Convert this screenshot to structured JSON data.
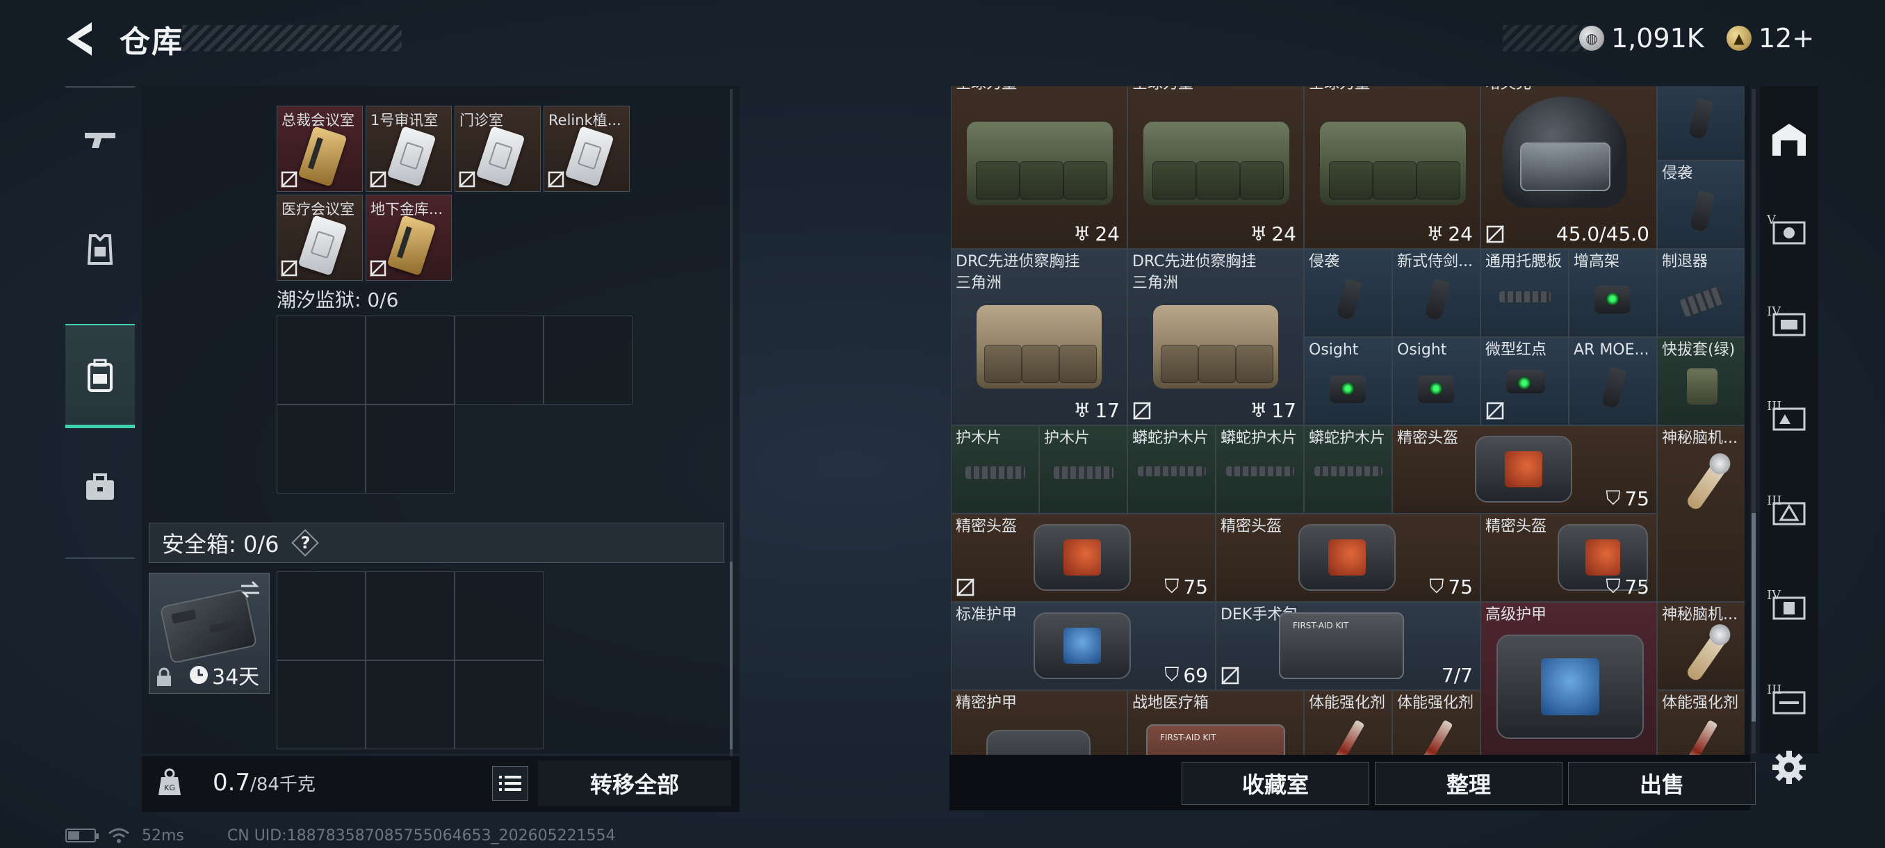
{
  "header": {
    "title": "仓库",
    "currency_silver": "1,091K",
    "currency_gold": "12+"
  },
  "left_nav": {
    "items": [
      {
        "icon": "gun-icon"
      },
      {
        "icon": "armor-vest-icon"
      },
      {
        "icon": "backpack-icon",
        "active": true
      },
      {
        "icon": "briefcase-icon"
      }
    ]
  },
  "left_panel": {
    "keycards": [
      {
        "label": "总裁会议室",
        "style": "gold",
        "bg": "red"
      },
      {
        "label": "1号审讯室",
        "style": "white",
        "bg": "brown"
      },
      {
        "label": "门诊室",
        "style": "white",
        "bg": "brown"
      },
      {
        "label": "Relink植...",
        "style": "white",
        "bg": "brown"
      },
      {
        "label": "医疗会议室",
        "style": "white",
        "bg": "brown"
      },
      {
        "label": "地下金库...",
        "style": "gold",
        "bg": "red"
      }
    ],
    "prison_section": "潮汐监狱: 0/6",
    "safebox_label": "安全箱: 0/6",
    "help_label": "?",
    "case_days": "34天",
    "weight_value": "0.7",
    "weight_max": "/84千克",
    "transfer_all": "转移全部"
  },
  "right_panel": {
    "items": [
      {
        "id": "r1",
        "label": "全球力量",
        "count": "24"
      },
      {
        "id": "r2",
        "label": "全球力量",
        "count": "24"
      },
      {
        "id": "r3",
        "label": "全球力量",
        "count": "24"
      },
      {
        "id": "r4",
        "label": "哈夫克",
        "count": "45.0/45.0"
      },
      {
        "id": "r5",
        "label": "侵袭"
      },
      {
        "id": "r6",
        "label": "DRC先进侦察胸挂",
        "label2": "三角洲",
        "count": "17"
      },
      {
        "id": "r7",
        "label": "DRC先进侦察胸挂",
        "label2": "三角洲",
        "count": "17"
      },
      {
        "id": "r8",
        "label": "侵袭"
      },
      {
        "id": "r9",
        "label": "新式侍剑..."
      },
      {
        "id": "r10",
        "label": "通用托腮板"
      },
      {
        "id": "r11",
        "label": "增高架"
      },
      {
        "id": "r12",
        "label": "制退器"
      },
      {
        "id": "r13",
        "label": "Osight"
      },
      {
        "id": "r14",
        "label": "Osight"
      },
      {
        "id": "r15",
        "label": "微型红点"
      },
      {
        "id": "r16",
        "label": "AR MOE..."
      },
      {
        "id": "r17",
        "label": "快拔套(绿)"
      },
      {
        "id": "r18",
        "label": "护木片"
      },
      {
        "id": "r19",
        "label": "护木片"
      },
      {
        "id": "r20",
        "label": "蟒蛇护木片"
      },
      {
        "id": "r21",
        "label": "蟒蛇护木片"
      },
      {
        "id": "r22",
        "label": "蟒蛇护木片"
      },
      {
        "id": "r23",
        "label": "精密头盔",
        "count": "75"
      },
      {
        "id": "r24",
        "label": "神秘脑机..."
      },
      {
        "id": "r25",
        "label": "精密头盔",
        "count": "75"
      },
      {
        "id": "r26",
        "label": "精密头盔",
        "count": "75"
      },
      {
        "id": "r27",
        "label": "精密头盔",
        "count": "75"
      },
      {
        "id": "r28",
        "label": "标准护甲",
        "count": "69"
      },
      {
        "id": "r29",
        "label": "DEK手术包",
        "count": "7/7"
      },
      {
        "id": "r30",
        "label": "高级护甲"
      },
      {
        "id": "r31",
        "label": "神秘脑机..."
      },
      {
        "id": "r32",
        "label": "精密护甲"
      },
      {
        "id": "r33",
        "label": "战地医疗箱"
      },
      {
        "id": "r34",
        "label": "体能强化剂"
      },
      {
        "id": "r35",
        "label": "体能强化剂"
      },
      {
        "id": "r36",
        "label": "体能强化剂"
      }
    ],
    "btn_collection": "收藏室",
    "btn_sort": "整理",
    "btn_sell": "出售"
  },
  "right_nav": {
    "items": [
      {
        "icon": "warehouse-icon",
        "roman": ""
      },
      {
        "icon": "storage-v-icon",
        "roman": "V"
      },
      {
        "icon": "storage-iv-icon",
        "roman": "IV"
      },
      {
        "icon": "storage-iii-icon",
        "roman": "III"
      },
      {
        "icon": "storage-iii-b-icon",
        "roman": "III"
      },
      {
        "icon": "storage-iv-b-icon",
        "roman": "IV"
      },
      {
        "icon": "storage-iii-c-icon",
        "roman": "III"
      }
    ]
  },
  "status": {
    "ping": "52ms",
    "uid": "CN UID:1887835870857550646​53_202605221554"
  },
  "colors": {
    "accent": "#3fd3b1",
    "panel": "#12181e"
  }
}
